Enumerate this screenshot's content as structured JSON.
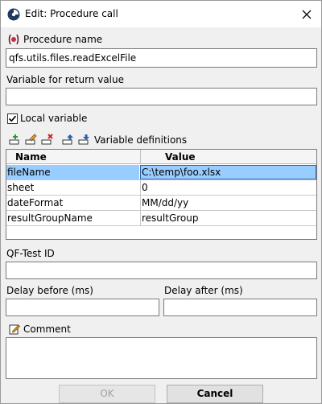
{
  "window": {
    "title": "Edit: Procedure call"
  },
  "procedure": {
    "label": "Procedure name",
    "value": "qfs.utils.files.readExcelFile"
  },
  "return_var": {
    "label": "Variable for return value",
    "value": ""
  },
  "local_variable": {
    "label": "Local variable",
    "checked": true
  },
  "var_defs": {
    "label": "Variable definitions",
    "toolbar_icons": [
      "add-row-icon",
      "edit-row-icon",
      "delete-row-icon",
      "move-up-icon",
      "move-down-icon"
    ],
    "columns": [
      "Name",
      "Value"
    ],
    "rows": [
      {
        "name": "fileName",
        "value": "C:\\temp\\foo.xlsx",
        "selected": true
      },
      {
        "name": "sheet",
        "value": "0",
        "selected": false
      },
      {
        "name": "dateFormat",
        "value": "MM/dd/yy",
        "selected": false
      },
      {
        "name": "resultGroupName",
        "value": "resultGroup",
        "selected": false
      }
    ]
  },
  "qftest_id": {
    "label": "QF-Test ID",
    "value": ""
  },
  "delay_before": {
    "label": "Delay before (ms)",
    "value": ""
  },
  "delay_after": {
    "label": "Delay after (ms)",
    "value": ""
  },
  "comment": {
    "label": "Comment",
    "value": ""
  },
  "buttons": {
    "ok": "OK",
    "cancel": "Cancel"
  },
  "colors": {
    "selection": "#99ccff",
    "procedure_icon": "#c0304a"
  }
}
